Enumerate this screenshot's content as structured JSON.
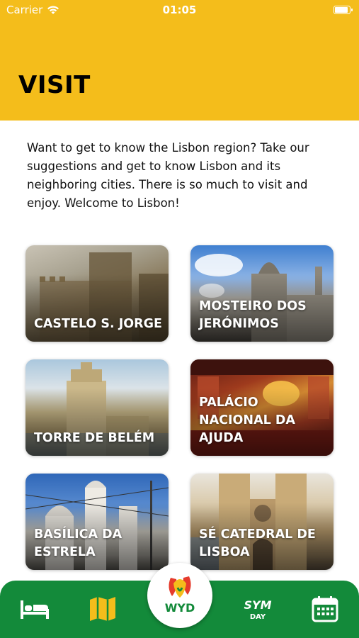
{
  "status_bar": {
    "carrier": "Carrier",
    "time": "01:05"
  },
  "page": {
    "title": "VISIT",
    "intro": "Want to get to know the Lisbon region? Take our suggestions and get to know Lisbon and its neighboring cities. There is so much to visit and enjoy. Welcome to Lisbon!"
  },
  "places": [
    {
      "name": "Castelo S. Jorge"
    },
    {
      "name": "Mosteiro dos Jerónimos"
    },
    {
      "name": "Torre de Belém"
    },
    {
      "name": "Palácio Nacional da Ajuda"
    },
    {
      "name": "Basílica da Estrela"
    },
    {
      "name": "Sé Catedral de Lisboa"
    }
  ],
  "tab_bar": {
    "items": [
      {
        "icon": "bed-icon"
      },
      {
        "icon": "map-icon",
        "active": true
      },
      {
        "icon": "wyd-logo",
        "logo_text": "WYD"
      },
      {
        "icon": "symday-icon",
        "text_top": "SYM",
        "text_bottom": "DAY"
      },
      {
        "icon": "calendar-icon"
      }
    ]
  },
  "colors": {
    "header": "#F4BD1B",
    "tab_bar": "#138A3A",
    "active_tab": "#F4BD1B"
  }
}
